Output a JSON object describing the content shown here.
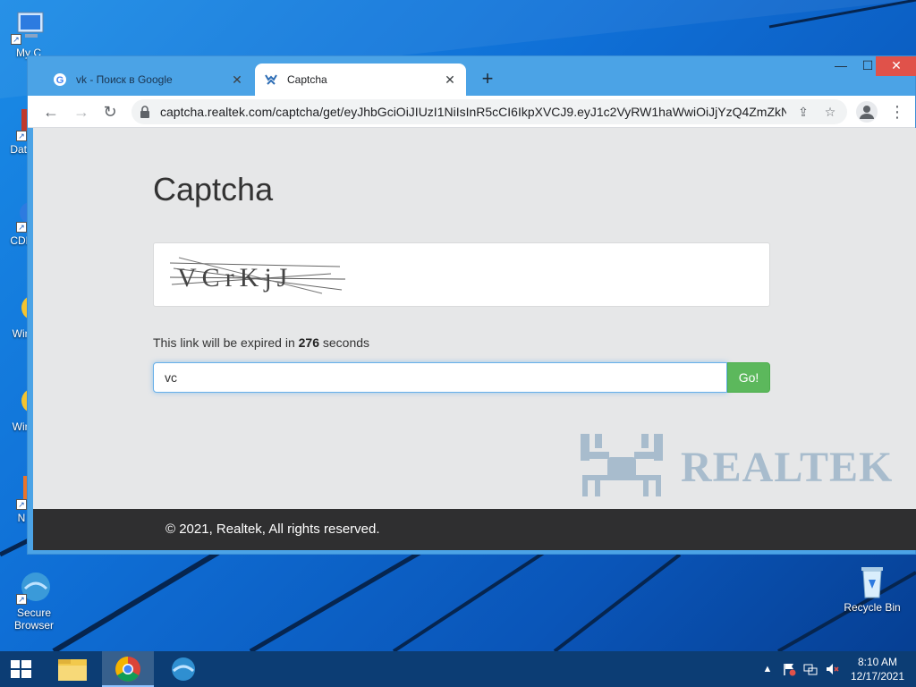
{
  "desktop": {
    "icons": [
      {
        "label": "My C",
        "icon": "computer-icon"
      },
      {
        "label": "Data",
        "icon": "database-icon"
      },
      {
        "label": "CDB",
        "icon": "cd-burner-icon"
      },
      {
        "label": "Win",
        "icon": "windows-app-icon"
      },
      {
        "label": "Win",
        "icon": "windows-app-icon"
      },
      {
        "label": "N",
        "icon": "app-icon"
      },
      {
        "label": "Secure Browser",
        "icon": "secure-browser-icon"
      },
      {
        "label": "Recycle Bin",
        "icon": "recycle-bin-icon"
      }
    ]
  },
  "browser": {
    "tabs": [
      {
        "title": "vk - Поиск в Google",
        "icon": "google-icon",
        "active": false
      },
      {
        "title": "Captcha",
        "icon": "realtek-icon",
        "active": true
      }
    ],
    "url": "captcha.realtek.com/captcha/get/eyJhbGciOiJIUzI1NiIsInR5cCI6IkpXVCJ9.eyJ1c2VyRW1haWwiOiJjYzQ4ZmZkNjg..."
  },
  "page": {
    "title": "Captcha",
    "captcha_text": "VCrKjJ",
    "expiry_prefix": "This link will be expired in",
    "expiry_seconds": "276",
    "expiry_suffix": "seconds",
    "input_value": "vc",
    "go_label": "Go!",
    "brand_name": "REALTEK",
    "footer": "© 2021, Realtek, All rights reserved."
  },
  "taskbar": {
    "apps": [
      "start-icon",
      "file-explorer-icon",
      "chrome-icon",
      "secure-browser-icon"
    ],
    "time": "8:10 AM",
    "date": "12/17/2021"
  },
  "colors": {
    "go_button": "#5cb85c",
    "footer_bg": "#2f2f30",
    "window_frame": "#4ba3e6",
    "brand": "#a8bccd"
  }
}
